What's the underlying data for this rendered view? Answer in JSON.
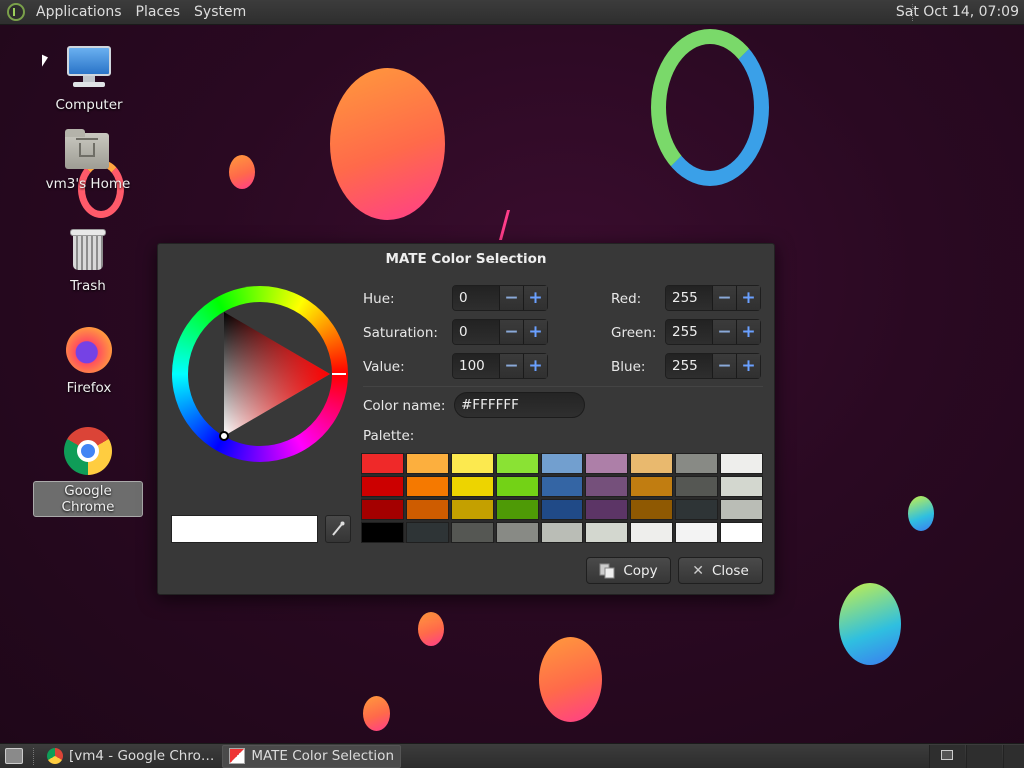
{
  "top_panel": {
    "menus": [
      "Applications",
      "Places",
      "System"
    ],
    "clock": "Sat Oct 14, 07:09"
  },
  "desktop_icons": [
    {
      "label": "Computer",
      "icon": "computer-icon"
    },
    {
      "label": "vm3's Home",
      "icon": "home-folder-icon"
    },
    {
      "label": "Trash",
      "icon": "trash-icon"
    },
    {
      "label": "Firefox",
      "icon": "firefox-icon"
    },
    {
      "label": "Google Chrome",
      "icon": "chrome-icon"
    }
  ],
  "dialog": {
    "title": "MATE Color Selection",
    "hue_label": "Hue:",
    "hue": "0",
    "saturation_label": "Saturation:",
    "saturation": "0",
    "value_label": "Value:",
    "value": "100",
    "red_label": "Red:",
    "red": "255",
    "green_label": "Green:",
    "green": "255",
    "blue_label": "Blue:",
    "blue": "255",
    "minus": "−",
    "plus": "+",
    "color_name_label": "Color name:",
    "color_name": "#FFFFFF",
    "palette_label": "Palette:",
    "palette": [
      "#ef2929",
      "#fcaf3e",
      "#fce94f",
      "#8ae234",
      "#729fcf",
      "#ad7fa8",
      "#e9b96e",
      "#888a85",
      "#eeeeec",
      "#cc0000",
      "#f57900",
      "#edd400",
      "#73d216",
      "#3465a4",
      "#75507b",
      "#c17d11",
      "#555753",
      "#d3d7cf",
      "#a40000",
      "#ce5c00",
      "#c4a000",
      "#4e9a06",
      "#204a87",
      "#5c3566",
      "#8f5902",
      "#2e3436",
      "#babdb6",
      "#000000",
      "#2e3436",
      "#555753",
      "#888a85",
      "#babdb6",
      "#d3d7cf",
      "#eeeeec",
      "#f3f3f3",
      "#ffffff"
    ],
    "current_color": "#FFFFFF",
    "copy_label": "Copy",
    "close_label": "Close"
  },
  "taskbar": {
    "tasks": [
      {
        "label": "[vm4 - Google Chro…",
        "icon": "chrome-icon"
      },
      {
        "label": "MATE Color Selection",
        "icon": "color-selection-icon"
      }
    ]
  }
}
